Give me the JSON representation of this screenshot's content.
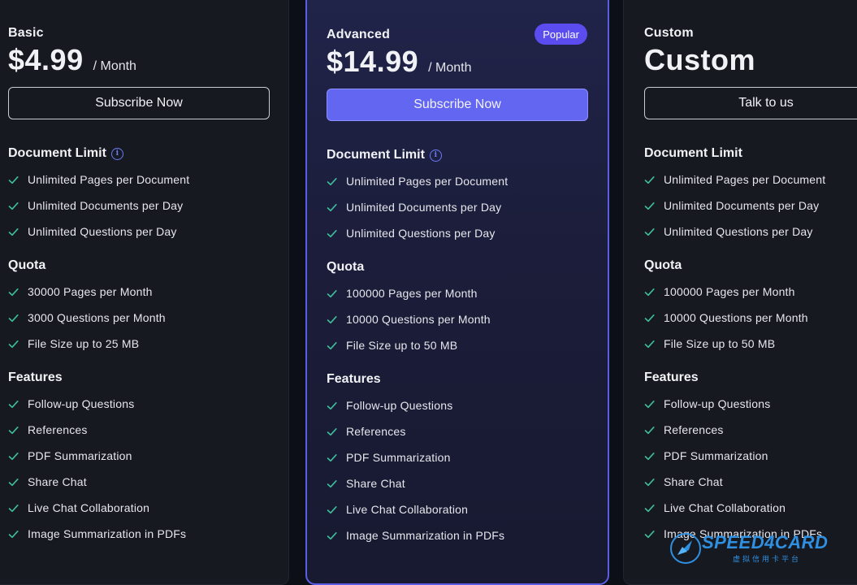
{
  "plans": [
    {
      "name": "Basic",
      "price": "$4.99",
      "period": "/ Month",
      "button": "Subscribe Now",
      "sections": [
        {
          "title": "Document Limit",
          "info": true,
          "items": [
            "Unlimited Pages per Document",
            "Unlimited Documents per Day",
            "Unlimited Questions per Day"
          ]
        },
        {
          "title": "Quota",
          "info": false,
          "items": [
            "30000 Pages per Month",
            "3000 Questions per Month",
            "File Size up to 25 MB"
          ]
        },
        {
          "title": "Features",
          "info": false,
          "items": [
            "Follow-up Questions",
            "References",
            "PDF Summarization",
            "Share Chat",
            "Live Chat Collaboration",
            "Image Summarization in PDFs"
          ]
        }
      ]
    },
    {
      "name": "Advanced",
      "badge": "Popular",
      "price": "$14.99",
      "period": "/ Month",
      "button": "Subscribe Now",
      "sections": [
        {
          "title": "Document Limit",
          "info": true,
          "items": [
            "Unlimited Pages per Document",
            "Unlimited Documents per Day",
            "Unlimited Questions per Day"
          ]
        },
        {
          "title": "Quota",
          "info": false,
          "items": [
            "100000 Pages per Month",
            "10000 Questions per Month",
            "File Size up to 50 MB"
          ]
        },
        {
          "title": "Features",
          "info": false,
          "items": [
            "Follow-up Questions",
            "References",
            "PDF Summarization",
            "Share Chat",
            "Live Chat Collaboration",
            "Image Summarization in PDFs"
          ]
        }
      ]
    },
    {
      "name": "Custom",
      "price": "Custom",
      "period": "",
      "button": "Talk to us",
      "sections": [
        {
          "title": "Document Limit",
          "info": false,
          "items": [
            "Unlimited Pages per Document",
            "Unlimited Documents per Day",
            "Unlimited Questions per Day"
          ]
        },
        {
          "title": "Quota",
          "info": false,
          "items": [
            "100000 Pages per Month",
            "10000 Questions per Month",
            "File Size up to 50 MB"
          ]
        },
        {
          "title": "Features",
          "info": false,
          "items": [
            "Follow-up Questions",
            "References",
            "PDF Summarization",
            "Share Chat",
            "Live Chat Collaboration",
            "Image Summarization in PDFs"
          ]
        }
      ]
    }
  ],
  "icons": {
    "check": "check-icon",
    "info": "info-icon"
  },
  "colors": {
    "accent": "#6366f1",
    "check": "#3fbf9a",
    "popular_badge": "#5b4cf0",
    "info": "#6a7cf6"
  },
  "watermark": {
    "text": "SPEED4CARD",
    "sub": "虚拟信用卡平台"
  }
}
